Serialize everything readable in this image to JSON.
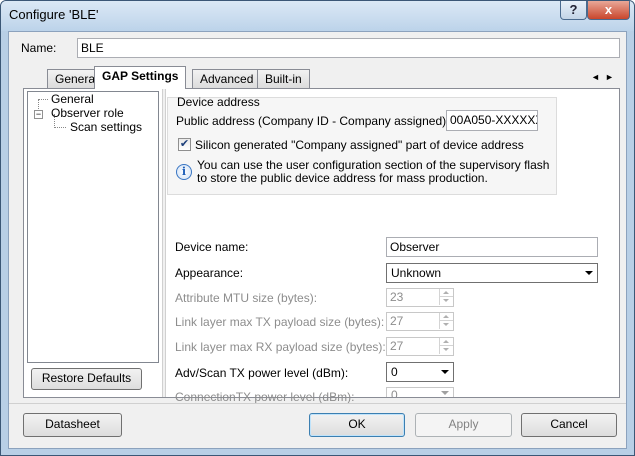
{
  "window": {
    "title": "Configure 'BLE'",
    "help_label": "?",
    "close_label": "x"
  },
  "name_field": {
    "label": "Name:",
    "value": "BLE"
  },
  "tabs": [
    {
      "label": "General"
    },
    {
      "label": "GAP Settings",
      "active": true
    },
    {
      "label": "Advanced"
    },
    {
      "label": "Built-in"
    }
  ],
  "tab_scroll": {
    "left": "◄",
    "right": "►"
  },
  "tree": {
    "items": [
      {
        "label": "General"
      },
      {
        "label": "Observer role",
        "expander": "−"
      },
      {
        "label": "Scan settings"
      }
    ],
    "restore_label": "Restore Defaults"
  },
  "device_address": {
    "group_label": "Device address",
    "public_address_label": "Public address (Company ID - Company assigned):",
    "public_address_value": "00A050-XXXXXX",
    "silicon_checkbox_label": "Silicon generated \"Company assigned\" part of device address",
    "silicon_checked": "✔",
    "info_line1": "You can use the user configuration section of the supervisory flash",
    "info_line2": "to store the public device address for mass production.",
    "info_icon_glyph": "i"
  },
  "settings": {
    "device_name_label": "Device name:",
    "device_name_value": "Observer",
    "appearance_label": "Appearance:",
    "appearance_value": "Unknown",
    "mtu_label": "Attribute MTU size (bytes):",
    "mtu_value": "23",
    "tx_payload_label": "Link layer max TX payload size (bytes):",
    "tx_payload_value": "27",
    "rx_payload_label": "Link layer max RX payload size (bytes):",
    "rx_payload_value": "27",
    "adv_power_label": "Adv/Scan TX power level (dBm):",
    "adv_power_value": "0",
    "conn_power_label": "ConnectionTX power level (dBm):",
    "conn_power_value": "0"
  },
  "footer": {
    "datasheet_label": "Datasheet",
    "ok_label": "OK",
    "apply_label": "Apply",
    "cancel_label": "Cancel"
  }
}
